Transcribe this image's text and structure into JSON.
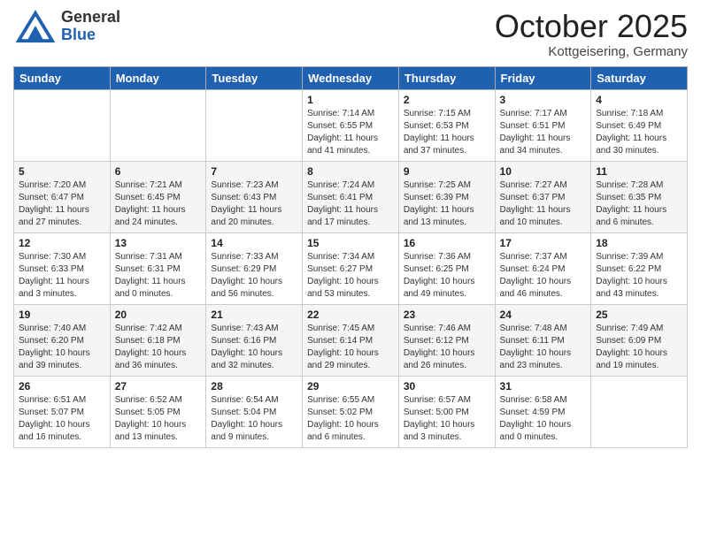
{
  "header": {
    "logo_general": "General",
    "logo_blue": "Blue",
    "month": "October 2025",
    "location": "Kottgeisering, Germany"
  },
  "weekdays": [
    "Sunday",
    "Monday",
    "Tuesday",
    "Wednesday",
    "Thursday",
    "Friday",
    "Saturday"
  ],
  "weeks": [
    [
      {
        "day": "",
        "info": ""
      },
      {
        "day": "",
        "info": ""
      },
      {
        "day": "",
        "info": ""
      },
      {
        "day": "1",
        "info": "Sunrise: 7:14 AM\nSunset: 6:55 PM\nDaylight: 11 hours\nand 41 minutes."
      },
      {
        "day": "2",
        "info": "Sunrise: 7:15 AM\nSunset: 6:53 PM\nDaylight: 11 hours\nand 37 minutes."
      },
      {
        "day": "3",
        "info": "Sunrise: 7:17 AM\nSunset: 6:51 PM\nDaylight: 11 hours\nand 34 minutes."
      },
      {
        "day": "4",
        "info": "Sunrise: 7:18 AM\nSunset: 6:49 PM\nDaylight: 11 hours\nand 30 minutes."
      }
    ],
    [
      {
        "day": "5",
        "info": "Sunrise: 7:20 AM\nSunset: 6:47 PM\nDaylight: 11 hours\nand 27 minutes."
      },
      {
        "day": "6",
        "info": "Sunrise: 7:21 AM\nSunset: 6:45 PM\nDaylight: 11 hours\nand 24 minutes."
      },
      {
        "day": "7",
        "info": "Sunrise: 7:23 AM\nSunset: 6:43 PM\nDaylight: 11 hours\nand 20 minutes."
      },
      {
        "day": "8",
        "info": "Sunrise: 7:24 AM\nSunset: 6:41 PM\nDaylight: 11 hours\nand 17 minutes."
      },
      {
        "day": "9",
        "info": "Sunrise: 7:25 AM\nSunset: 6:39 PM\nDaylight: 11 hours\nand 13 minutes."
      },
      {
        "day": "10",
        "info": "Sunrise: 7:27 AM\nSunset: 6:37 PM\nDaylight: 11 hours\nand 10 minutes."
      },
      {
        "day": "11",
        "info": "Sunrise: 7:28 AM\nSunset: 6:35 PM\nDaylight: 11 hours\nand 6 minutes."
      }
    ],
    [
      {
        "day": "12",
        "info": "Sunrise: 7:30 AM\nSunset: 6:33 PM\nDaylight: 11 hours\nand 3 minutes."
      },
      {
        "day": "13",
        "info": "Sunrise: 7:31 AM\nSunset: 6:31 PM\nDaylight: 11 hours\nand 0 minutes."
      },
      {
        "day": "14",
        "info": "Sunrise: 7:33 AM\nSunset: 6:29 PM\nDaylight: 10 hours\nand 56 minutes."
      },
      {
        "day": "15",
        "info": "Sunrise: 7:34 AM\nSunset: 6:27 PM\nDaylight: 10 hours\nand 53 minutes."
      },
      {
        "day": "16",
        "info": "Sunrise: 7:36 AM\nSunset: 6:25 PM\nDaylight: 10 hours\nand 49 minutes."
      },
      {
        "day": "17",
        "info": "Sunrise: 7:37 AM\nSunset: 6:24 PM\nDaylight: 10 hours\nand 46 minutes."
      },
      {
        "day": "18",
        "info": "Sunrise: 7:39 AM\nSunset: 6:22 PM\nDaylight: 10 hours\nand 43 minutes."
      }
    ],
    [
      {
        "day": "19",
        "info": "Sunrise: 7:40 AM\nSunset: 6:20 PM\nDaylight: 10 hours\nand 39 minutes."
      },
      {
        "day": "20",
        "info": "Sunrise: 7:42 AM\nSunset: 6:18 PM\nDaylight: 10 hours\nand 36 minutes."
      },
      {
        "day": "21",
        "info": "Sunrise: 7:43 AM\nSunset: 6:16 PM\nDaylight: 10 hours\nand 32 minutes."
      },
      {
        "day": "22",
        "info": "Sunrise: 7:45 AM\nSunset: 6:14 PM\nDaylight: 10 hours\nand 29 minutes."
      },
      {
        "day": "23",
        "info": "Sunrise: 7:46 AM\nSunset: 6:12 PM\nDaylight: 10 hours\nand 26 minutes."
      },
      {
        "day": "24",
        "info": "Sunrise: 7:48 AM\nSunset: 6:11 PM\nDaylight: 10 hours\nand 23 minutes."
      },
      {
        "day": "25",
        "info": "Sunrise: 7:49 AM\nSunset: 6:09 PM\nDaylight: 10 hours\nand 19 minutes."
      }
    ],
    [
      {
        "day": "26",
        "info": "Sunrise: 6:51 AM\nSunset: 5:07 PM\nDaylight: 10 hours\nand 16 minutes."
      },
      {
        "day": "27",
        "info": "Sunrise: 6:52 AM\nSunset: 5:05 PM\nDaylight: 10 hours\nand 13 minutes."
      },
      {
        "day": "28",
        "info": "Sunrise: 6:54 AM\nSunset: 5:04 PM\nDaylight: 10 hours\nand 9 minutes."
      },
      {
        "day": "29",
        "info": "Sunrise: 6:55 AM\nSunset: 5:02 PM\nDaylight: 10 hours\nand 6 minutes."
      },
      {
        "day": "30",
        "info": "Sunrise: 6:57 AM\nSunset: 5:00 PM\nDaylight: 10 hours\nand 3 minutes."
      },
      {
        "day": "31",
        "info": "Sunrise: 6:58 AM\nSunset: 4:59 PM\nDaylight: 10 hours\nand 0 minutes."
      },
      {
        "day": "",
        "info": ""
      }
    ]
  ]
}
